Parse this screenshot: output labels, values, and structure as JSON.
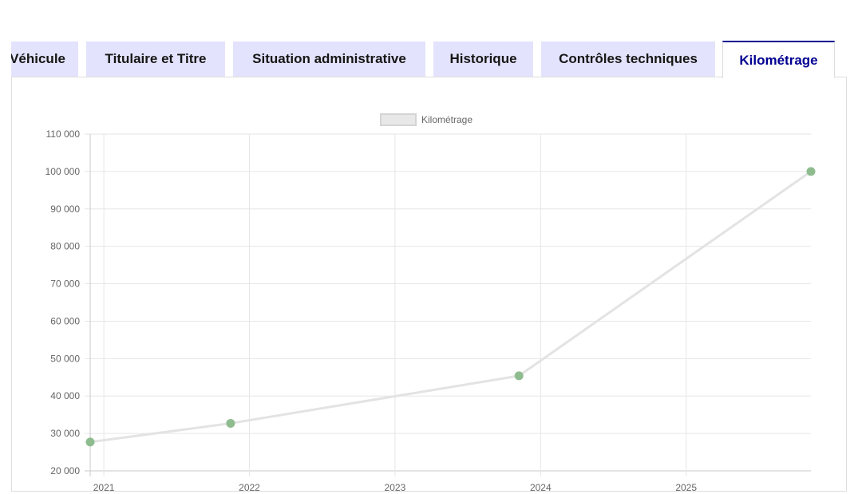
{
  "tabs": [
    {
      "label": "Véhicule",
      "active": false
    },
    {
      "label": "Titulaire et Titre",
      "active": false
    },
    {
      "label": "Situation administrative",
      "active": false
    },
    {
      "label": "Historique",
      "active": false
    },
    {
      "label": "Contrôles techniques",
      "active": false
    },
    {
      "label": "Kilométrage",
      "active": true
    }
  ],
  "colors": {
    "tab_bg": "#e3e3fd",
    "active_tab_text": "#000091",
    "line": "#e3e3e3",
    "point": "#8fbc8f"
  },
  "chart_data": {
    "type": "line",
    "legend": {
      "label": "Kilométrage",
      "position": "top"
    },
    "series": [
      {
        "name": "Kilométrage",
        "x": [
          "2020-11-27",
          "2021-11-15",
          "2023-11-08",
          "2025-11-10"
        ],
        "y": [
          27700,
          32700,
          45400,
          100000
        ]
      }
    ],
    "x_axis": {
      "type": "time",
      "range": [
        "2020-11-27",
        "2025-11-10"
      ],
      "ticks": [
        "2021",
        "2022",
        "2023",
        "2024",
        "2025"
      ]
    },
    "y_axis": {
      "range": [
        20000,
        110000
      ],
      "ticks": [
        "20 000",
        "30 000",
        "40 000",
        "50 000",
        "60 000",
        "70 000",
        "80 000",
        "90 000",
        "100 000",
        "110 000"
      ]
    },
    "grid": true
  }
}
